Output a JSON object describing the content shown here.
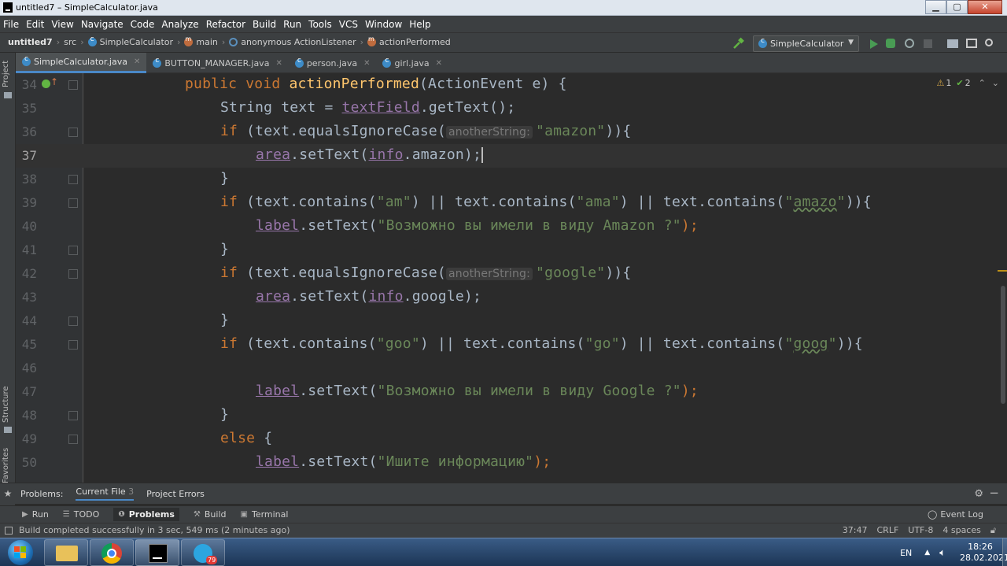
{
  "window": {
    "title": "untitled7 – SimpleCalculator.java",
    "buttons": [
      "minimize",
      "maximize",
      "close"
    ]
  },
  "menu": [
    "File",
    "Edit",
    "View",
    "Navigate",
    "Code",
    "Analyze",
    "Refactor",
    "Build",
    "Run",
    "Tools",
    "VCS",
    "Window",
    "Help"
  ],
  "breadcrumbs": {
    "project": "untitled7",
    "src": "src",
    "class": "SimpleCalculator",
    "method": "main",
    "anon": "anonymous ActionListener",
    "action": "actionPerformed"
  },
  "run_config": "SimpleCalculator",
  "side_labels": {
    "project": "Project",
    "structure": "Structure",
    "favorites": "Favorites"
  },
  "tabs": [
    {
      "label": "SimpleCalculator.java",
      "active": true
    },
    {
      "label": "BUTTON_MANAGER.java",
      "active": false
    },
    {
      "label": "person.java",
      "active": false
    },
    {
      "label": "girl.java",
      "active": false
    }
  ],
  "inspections": {
    "warnings": "1",
    "ok": "2"
  },
  "editor": {
    "current_line": "37",
    "lines": [
      "34",
      "35",
      "36",
      "37",
      "38",
      "39",
      "40",
      "41",
      "42",
      "43",
      "44",
      "45",
      "46",
      "47",
      "48",
      "49",
      "50"
    ],
    "hint_label": "anotherString:"
  },
  "code_text": {
    "l34_a": "public void ",
    "l34_b": "actionPerformed",
    "l34_c": "(ActionEvent e) {",
    "l35_a": "String text = ",
    "l35_b": "textField",
    "l35_c": ".getText();",
    "l36_a": "if ",
    "l36_b": "(text.equalsIgnoreCase(",
    "l36_c": "\"amazon\"",
    "l36_d": ")){",
    "l37_a": "area",
    "l37_b": ".setText(",
    "l37_c": "info",
    "l37_d": ".amazon);",
    "l38": "}",
    "l39_a": "if ",
    "l39_b": "(text.contains(",
    "l39_c": "\"am\"",
    "l39_d": ") || text.contains(",
    "l39_e": "\"ama\"",
    "l39_f": ") || text.contains(",
    "l39_g": "\"",
    "l39_h": "amazo",
    "l39_i": "\"",
    "l39_j": ")){",
    "l40_a": "label",
    "l40_b": ".setText(",
    "l40_c": "\"Возможно вы имели в виду Amazon ?\"",
    "l40_d": ");",
    "l41": "}",
    "l42_a": "if ",
    "l42_b": "(text.equalsIgnoreCase(",
    "l42_c": "\"google\"",
    "l42_d": ")){",
    "l43_a": "area",
    "l43_b": ".setText(",
    "l43_c": "info",
    "l43_d": ".google);",
    "l44": "}",
    "l45_a": "if ",
    "l45_b": "(text.contains(",
    "l45_c": "\"goo\"",
    "l45_d": ") || text.contains(",
    "l45_e": "\"go\"",
    "l45_f": ") || text.contains(",
    "l45_g": "\"",
    "l45_h": "goog",
    "l45_i": "\"",
    "l45_j": ")){",
    "l47_a": "label",
    "l47_b": ".setText(",
    "l47_c": "\"Возможно вы имели в виду Google ?\"",
    "l47_d": ");",
    "l48": "}",
    "l49_a": "else ",
    "l49_b": "{",
    "l50_a": "label",
    "l50_b": ".setText(",
    "l50_c": "\"Ишите информацию\"",
    "l50_d": ");"
  },
  "problems": {
    "label": "Problems:",
    "tabs": [
      {
        "label": "Current File",
        "count": "3",
        "active": true
      },
      {
        "label": "Project Errors",
        "count": "",
        "active": false
      }
    ]
  },
  "tool_buttons": [
    "Run",
    "TODO",
    "Problems",
    "Build",
    "Terminal"
  ],
  "event_log": "Event Log",
  "status": {
    "message": "Build completed successfully in 3 sec, 549 ms (2 minutes ago)",
    "position": "37:47",
    "line_sep": "CRLF",
    "encoding": "UTF-8",
    "indent": "4 spaces"
  },
  "taskbar": {
    "lang": "EN",
    "time": "18:26",
    "date": "28.02.2021",
    "telegram_badge": "79"
  },
  "colors": {
    "keyword": "#cc7832",
    "method_decl": "#ffc66d",
    "string": "#6a8759",
    "field": "#9876aa",
    "default_text": "#a9b7c6",
    "editor_bg": "#2b2b2b"
  }
}
